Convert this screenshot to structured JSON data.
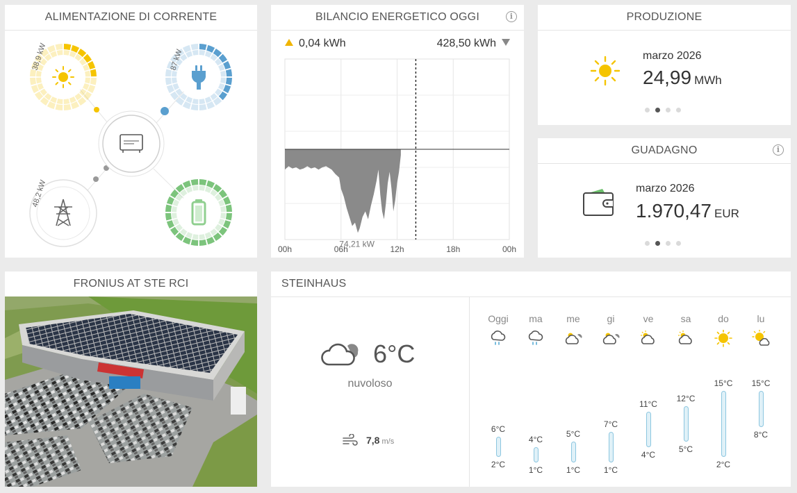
{
  "power_flow": {
    "title": "ALIMENTAZIONE DI CORRENTE",
    "pv_label": "38,9 kW",
    "pv_fraction": 0.25,
    "grid_label": "87 kW",
    "grid_fraction": 0.35,
    "load_label": "48,2 kW",
    "load_fraction": 0.0,
    "battery_fraction": 1.0,
    "colors": {
      "pv": "#f5c400",
      "grid": "#5a9fcf",
      "battery": "#7cc47c",
      "neutral": "#999999"
    }
  },
  "balance": {
    "title": "BILANCIO ENERGETICO OGGI",
    "produced": "0,04 kWh",
    "consumed": "428,50 kWh",
    "peak_label": "74,21 kW"
  },
  "chart_data": {
    "type": "area",
    "x_ticks": [
      "00h",
      "06h",
      "12h",
      "18h",
      "00h"
    ],
    "xlim_hours": [
      0,
      24
    ],
    "ylim_kw": [
      -80,
      80
    ],
    "now_hour": 14,
    "series": [
      {
        "x": [
          0,
          0.4,
          0.8,
          1.2,
          1.6,
          2,
          2.4,
          2.8,
          3.2,
          3.6,
          4,
          4.4,
          4.8,
          5,
          5.4,
          5.8,
          6,
          6.3,
          6.6,
          6.9,
          7.2,
          7.5,
          7.8,
          8,
          8.3,
          8.6,
          8.9,
          9.2,
          9.5,
          9.8,
          10,
          10.2,
          10.4,
          10.6,
          10.8,
          11,
          11.2,
          11.4,
          11.6,
          11.8,
          12,
          12.2,
          12.4
        ],
        "y": [
          -18,
          -15,
          -17,
          -16,
          -18,
          -17,
          -15,
          -17,
          -16,
          -18,
          -16,
          -15,
          -17,
          -18,
          -22,
          -25,
          -35,
          -42,
          -52,
          -60,
          -68,
          -65,
          -74,
          -70,
          -60,
          -55,
          -62,
          -50,
          -40,
          -28,
          -18,
          -40,
          -55,
          -62,
          -48,
          -30,
          -20,
          -35,
          -55,
          -45,
          -30,
          -20,
          -5
        ]
      }
    ]
  },
  "production": {
    "title": "PRODUZIONE",
    "month": "marzo 2026",
    "value": "24,99",
    "unit": "MWh",
    "icon": "sun-icon"
  },
  "yield": {
    "title": "GUADAGNO",
    "month": "marzo 2026",
    "value": "1.970,47",
    "unit": "EUR",
    "icon": "wallet-icon"
  },
  "photo": {
    "title": "FRONIUS AT STE RCI"
  },
  "weather": {
    "title": "STEINHAUS",
    "current_temp": "6°C",
    "condition": "nuvoloso",
    "wind_value": "7,8",
    "wind_unit": "m/s",
    "days": [
      {
        "label": "Oggi",
        "icon": "rain",
        "high": "6°C",
        "low": "2°C",
        "high_v": 6,
        "low_v": 2
      },
      {
        "label": "ma",
        "icon": "rain",
        "high": "4°C",
        "low": "1°C",
        "high_v": 4,
        "low_v": 1
      },
      {
        "label": "me",
        "icon": "partly-cloudy-dark",
        "high": "5°C",
        "low": "1°C",
        "high_v": 5,
        "low_v": 1
      },
      {
        "label": "gi",
        "icon": "partly-cloudy-dark",
        "high": "7°C",
        "low": "1°C",
        "high_v": 7,
        "low_v": 1
      },
      {
        "label": "ve",
        "icon": "partly-cloudy",
        "high": "11°C",
        "low": "4°C",
        "high_v": 11,
        "low_v": 4
      },
      {
        "label": "sa",
        "icon": "partly-cloudy",
        "high": "12°C",
        "low": "5°C",
        "high_v": 12,
        "low_v": 5
      },
      {
        "label": "do",
        "icon": "sunny",
        "high": "15°C",
        "low": "2°C",
        "high_v": 15,
        "low_v": 2
      },
      {
        "label": "lu",
        "icon": "sunny-cloud",
        "high": "15°C",
        "low": "8°C",
        "high_v": 15,
        "low_v": 8
      }
    ]
  }
}
